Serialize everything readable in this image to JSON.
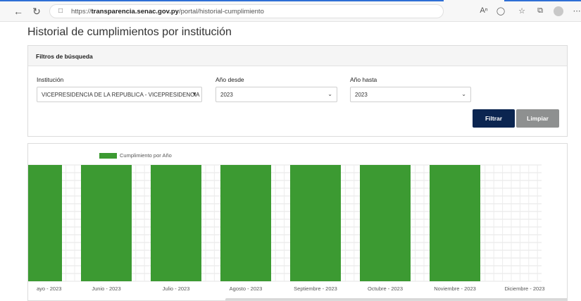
{
  "browser": {
    "url_prefix": "https://",
    "url_domain": "transparencia.senac.gov.py",
    "url_path": "/portal/historial-cumplimiento"
  },
  "page": {
    "title": "Historial de cumplimientos por institución"
  },
  "filters": {
    "header": "Filtros de búsqueda",
    "institucion_label": "Institución",
    "institucion_value": "VICEPRESIDENCIA DE LA REPUBLICA - VICEPRESIDENCIA",
    "anio_desde_label": "Año desde",
    "anio_desde_value": "2023",
    "anio_hasta_label": "Año hasta",
    "anio_hasta_value": "2023",
    "filtrar_label": "Filtrar",
    "limpiar_label": "Limpiar"
  },
  "colors": {
    "bar": "#3c9a32",
    "filtrar_button": "#0b2550",
    "limpiar_button": "#8e9090"
  },
  "chart_data": {
    "type": "bar",
    "legend": "Cumplimiento por Año",
    "categories": [
      "ayo - 2023",
      "Junio - 2023",
      "Julio - 2023",
      "Agosto - 2023",
      "Septiembre - 2023",
      "Octubre - 2023",
      "Noviembre - 2023",
      "Diciembre - 2023"
    ],
    "series": [
      {
        "name": "Cumplimiento por Año",
        "values": [
          100,
          100,
          100,
          100,
          100,
          100,
          100,
          0
        ]
      }
    ],
    "ylim": [
      0,
      100
    ],
    "grid": true,
    "legend_position": "top-left"
  }
}
